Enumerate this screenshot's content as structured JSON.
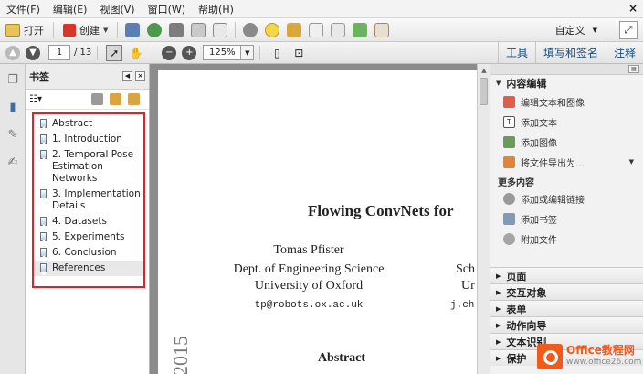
{
  "menu": {
    "items": [
      "文件(F)",
      "编辑(E)",
      "视图(V)",
      "窗口(W)",
      "帮助(H)"
    ],
    "close_symbol": "×"
  },
  "toolbar": {
    "open_label": "打开",
    "create_label": "创建",
    "customize_label": "自定义",
    "icons": [
      "save-icon",
      "upload-icon",
      "print-icon",
      "edit-icon",
      "email-icon",
      "gear-icon",
      "comment-icon",
      "sign-icon",
      "delete-icon",
      "lock-icon",
      "share-icon",
      "stamp-icon"
    ]
  },
  "nav": {
    "page_current": "1",
    "page_total": "/ 13",
    "zoom": "125%",
    "tabs": [
      "工具",
      "填写和签名",
      "注释"
    ]
  },
  "bookmarks": {
    "title": "书签",
    "items": [
      {
        "label": "Abstract"
      },
      {
        "label": "1. Introduction"
      },
      {
        "label": "2. Temporal Pose Estimation Networks"
      },
      {
        "label": "3. Implementation Details"
      },
      {
        "label": "4. Datasets"
      },
      {
        "label": "5. Experiments"
      },
      {
        "label": "6. Conclusion"
      },
      {
        "label": "References"
      }
    ]
  },
  "document": {
    "title": "Flowing ConvNets for",
    "author_name": "Tomas Pfister",
    "author_dept": "Dept. of Engineering Science",
    "author_univ": "University of Oxford",
    "author_email": "tp@robots.ox.ac.uk",
    "coauthor_line1": "Sch",
    "coauthor_line2": "Ur",
    "coauthor_email": "j.ch",
    "abstract_heading": "Abstract",
    "year_margin": "2015"
  },
  "rightpane": {
    "content_edit_title": "内容编辑",
    "items": [
      {
        "label": "编辑文本和图像",
        "icon": "edit-text-image-icon"
      },
      {
        "label": "添加文本",
        "icon": "add-text-icon"
      },
      {
        "label": "添加图像",
        "icon": "add-image-icon"
      },
      {
        "label": "将文件导出为...",
        "icon": "export-icon"
      }
    ],
    "more_title": "更多内容",
    "more_items": [
      {
        "label": "添加或编辑链接",
        "icon": "link-icon"
      },
      {
        "label": "添加书签",
        "icon": "bookmark-add-icon"
      },
      {
        "label": "附加文件",
        "icon": "attach-icon"
      }
    ],
    "collapsed": [
      "页面",
      "交互对象",
      "表单",
      "动作向导",
      "文本识别",
      "保护"
    ]
  },
  "watermark": {
    "brand": "Office教程网",
    "url": "www.office26.com"
  },
  "colors": {
    "highlight_border": "#e0202a",
    "watermark_orange": "#f05a1a",
    "tab_blue": "#1a4b7a"
  }
}
